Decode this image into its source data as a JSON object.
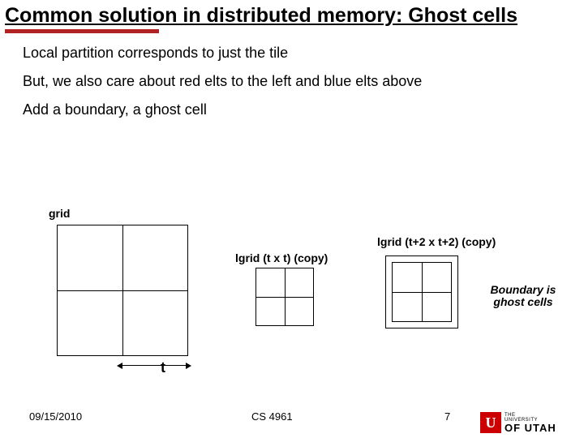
{
  "title": "Common solution in distributed memory: Ghost cells",
  "bullets": {
    "b1": "Local partition corresponds to just the tile",
    "b2": "But, we also care about red elts to the left and blue elts above",
    "b3": "Add a boundary, a ghost cell"
  },
  "diagram": {
    "grid_label": "grid",
    "lgrid_txt_label": "lgrid (t x t) (copy)",
    "lgrid_ghost_label": "lgrid (t+2 x t+2) (copy)",
    "ghost_note": "Boundary is ghost cells",
    "t_label": "t"
  },
  "footer": {
    "date": "09/15/2010",
    "course": "CS 4961",
    "page": "7"
  },
  "logo": {
    "letter": "U",
    "line1": "THE",
    "line2": "UNIVERSITY",
    "line3": "OF UTAH"
  }
}
